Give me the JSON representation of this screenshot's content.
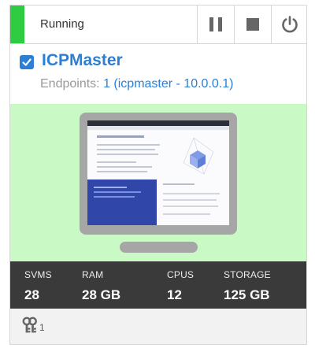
{
  "status": {
    "text": "Running",
    "color": "#2ecc40"
  },
  "controls": {
    "pause": "pause-icon",
    "stop": "stop-icon",
    "power": "power-icon"
  },
  "vm": {
    "name": "ICPMaster",
    "checked": true,
    "endpoints_label": "Endpoints:",
    "endpoints_value": "1 (icpmaster - 10.0.0.1)"
  },
  "stats": [
    {
      "label": "SVMS",
      "value": "28"
    },
    {
      "label": "RAM",
      "value": "28 GB"
    },
    {
      "label": "CPUS",
      "value": "12"
    },
    {
      "label": "STORAGE",
      "value": "125 GB"
    }
  ],
  "footer": {
    "keys_icon": "keys-icon",
    "keys_count": "1"
  },
  "colors": {
    "accent": "#2d7fd6",
    "preview_bg": "#c9fac6",
    "stats_bg": "#3a3a3a"
  }
}
